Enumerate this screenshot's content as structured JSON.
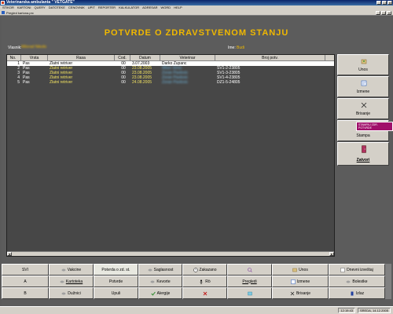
{
  "window": {
    "title": "Veterinarska ambulanta \" VETGATE\""
  },
  "menu": [
    "STIKOR",
    "KARTONI",
    "QUERY",
    "DATOTEKE",
    "CENOVNIK",
    "UPIT",
    "REPORTER",
    "KALKULATOR",
    "ADRESAR",
    "WORD",
    "HELP"
  ],
  "document": {
    "title": "Pregled kartona.prc"
  },
  "heading": "POTVRDE O ZDRAVSTVENOM STANJU",
  "owner": {
    "label": "Vlasnik:",
    "value": "Milorad Nikolic"
  },
  "pet_name": {
    "label": "Ime:",
    "value": "Budi"
  },
  "grid": {
    "columns": [
      "No.",
      "Vrsta",
      "Rasa",
      "Cod.",
      "Datum",
      "Veterinar",
      "Broj potv."
    ],
    "rows": [
      {
        "no": "1",
        "vrsta": "Pas",
        "rasa": "Zlatni retriver",
        "cod": "00",
        "datum": "3.07.2003",
        "veterinar": "Darko Zupanc",
        "broj": ""
      },
      {
        "no": "2",
        "vrsta": "Pas",
        "rasa": "Zlatni retriver",
        "cod": "00",
        "datum": "23.08.2005",
        "veterinar": "Milan Simic",
        "broj": "SV1-2-23805"
      },
      {
        "no": "3",
        "vrsta": "Pas",
        "rasa": "Zlatni retriver",
        "cod": "00",
        "datum": "23.08.2005",
        "veterinar": "Zoran Pavlovic",
        "broj": "SV1-3-23805"
      },
      {
        "no": "4",
        "vrsta": "Pas",
        "rasa": "Zlatni retriver",
        "cod": "00",
        "datum": "23.08.2005",
        "veterinar": "Zoran Pavlovic",
        "broj": "SV1-4-23805"
      },
      {
        "no": "5",
        "vrsta": "Pas",
        "rasa": "Zlatni retriver",
        "cod": "00",
        "datum": "24.08.2005",
        "veterinar": "Zoran Pavlovic",
        "broj": "DZ1-5-24805"
      }
    ]
  },
  "side_buttons": [
    {
      "label": "Unos",
      "icon": "add-icon",
      "color": "#2a8a2a"
    },
    {
      "label": "Izmene",
      "icon": "edit-icon",
      "color": "#2a5fbf"
    },
    {
      "label": "Brisanje",
      "icon": "delete-icon",
      "color": "#222222"
    },
    {
      "label": "Stampa",
      "icon": "printer-icon",
      "color": "#606060"
    },
    {
      "label": "Zatvori",
      "icon": "door-icon",
      "color": "#b03060"
    }
  ],
  "tooltip": "STAMPAJ ZDR. POTVRDE",
  "bottom_buttons": [
    {
      "label": "SVI",
      "icon": "",
      "color": ""
    },
    {
      "label": "Vakcine",
      "icon": "syringe-icon",
      "color": "#888888"
    },
    {
      "label": "Potvrda o zd. st.",
      "icon": "",
      "color": ""
    },
    {
      "label": "Saglasnost",
      "icon": "document-icon",
      "color": "#888888"
    },
    {
      "label": "Zakazano",
      "icon": "clock-icon",
      "color": "#000000"
    },
    {
      "label": "",
      "icon": "zoom-icon",
      "color": "#8040a0"
    },
    {
      "label": "Unos",
      "icon": "add-icon",
      "color": "#2a8a2a"
    },
    {
      "label": "Dnevni izveštaj",
      "icon": "report-icon",
      "color": "#444444"
    },
    {
      "label": "A",
      "icon": "",
      "color": ""
    },
    {
      "label": "Kartoteka",
      "icon": "folder-icon",
      "color": "#888888"
    },
    {
      "label": "Potvrde",
      "icon": "",
      "color": ""
    },
    {
      "label": "Kevorte",
      "icon": "note-icon",
      "color": "#888888"
    },
    {
      "label": "Rö",
      "icon": "person-icon",
      "color": "#000000"
    },
    {
      "label": "Pregledi",
      "icon": "",
      "color": ""
    },
    {
      "label": "Izmene",
      "icon": "edit-icon",
      "color": "#2a5fbf"
    },
    {
      "label": "Bolestke",
      "icon": "list-icon",
      "color": "#888888"
    },
    {
      "label": "B",
      "icon": "",
      "color": ""
    },
    {
      "label": "Dužnici",
      "icon": "money-icon",
      "color": "#888888"
    },
    {
      "label": "Upuli",
      "icon": "",
      "color": ""
    },
    {
      "label": "Alergije",
      "icon": "check-icon",
      "color": "#2a8a2a"
    },
    {
      "label": "",
      "icon": "cross-icon",
      "color": "#c02020"
    },
    {
      "label": "",
      "icon": "table-icon",
      "color": "#40a0c0"
    },
    {
      "label": "Brisanje",
      "icon": "delete-icon",
      "color": "#222222"
    },
    {
      "label": "Izlaz",
      "icon": "door-icon",
      "color": "#2040a0"
    }
  ],
  "status": {
    "time": "12:19:43",
    "date": "SREDA, 14.12.2005"
  }
}
